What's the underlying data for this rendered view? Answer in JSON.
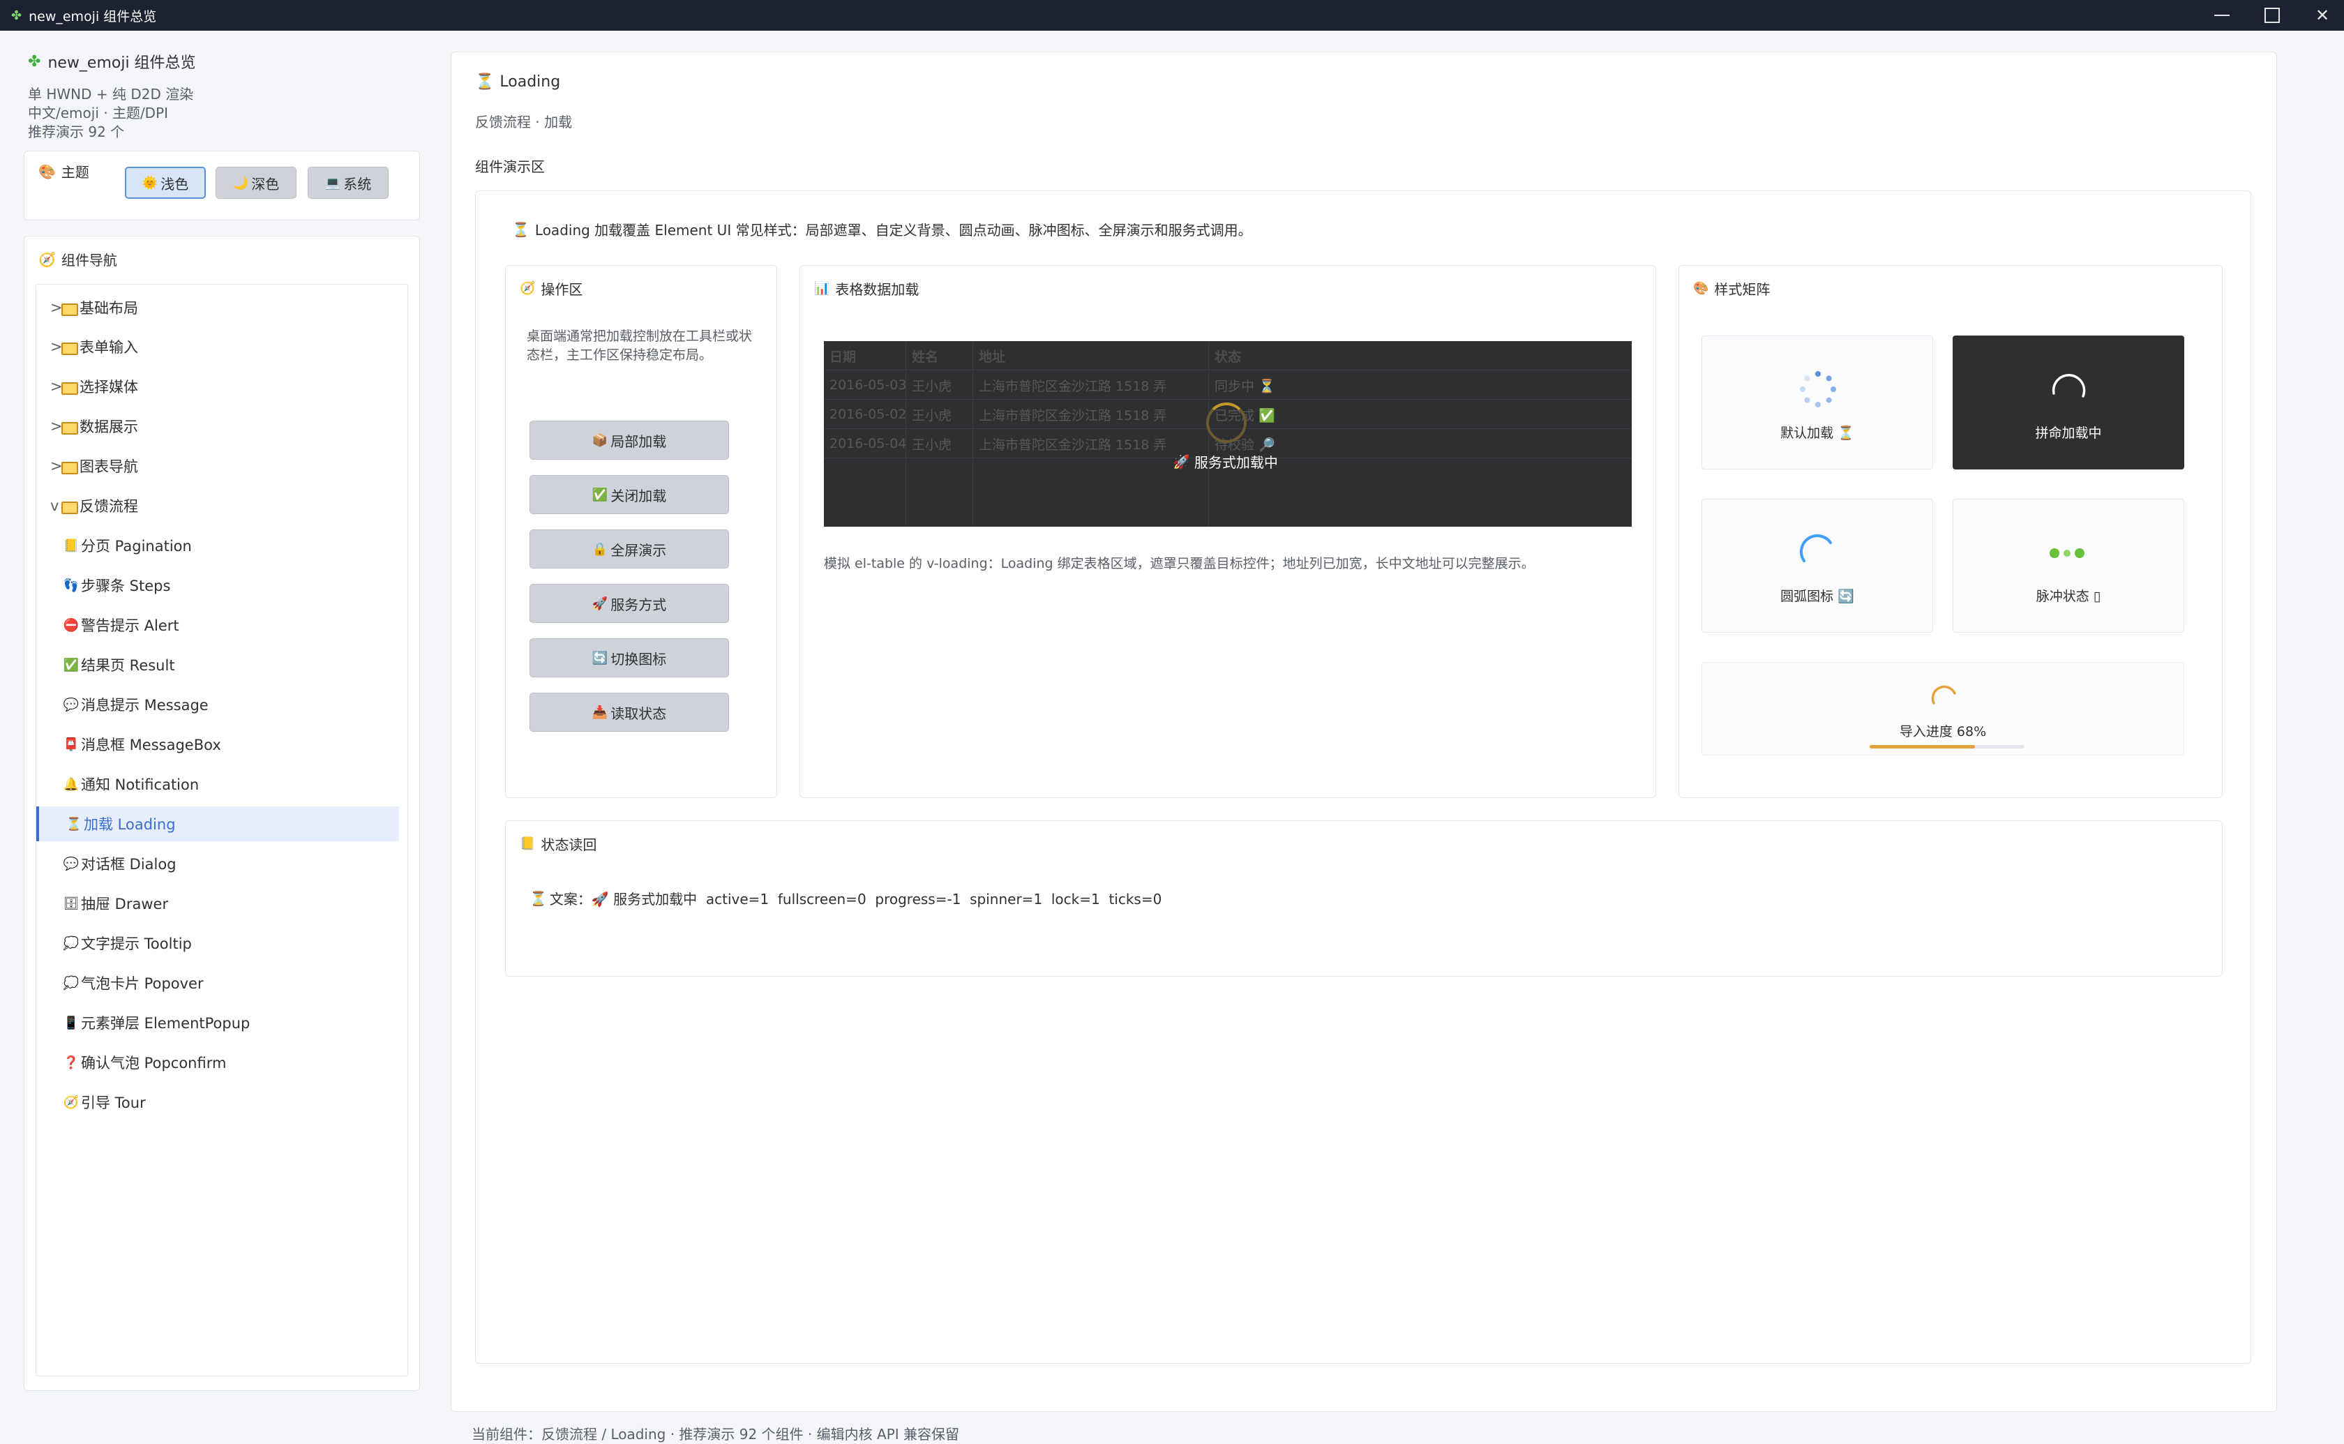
{
  "window": {
    "title": "new_emoji 组件总览",
    "icon": "clover-icon"
  },
  "sidebar": {
    "app_name": "new_emoji 组件总览",
    "meta_lines": [
      "单 HWND + 纯 D2D 渲染",
      "中文/emoji · 主题/DPI",
      "推荐演示 92 个"
    ],
    "theme": {
      "label": "主题",
      "buttons": [
        {
          "label": "浅色",
          "icon": "sun-icon",
          "selected": true
        },
        {
          "label": "深色",
          "icon": "moon-icon",
          "selected": false
        },
        {
          "label": "系统",
          "icon": "laptop-icon",
          "selected": false
        }
      ]
    },
    "nav": {
      "title": "组件导航",
      "groups": [
        {
          "prefix": ">",
          "label": "基础布局"
        },
        {
          "prefix": ">",
          "label": "表单输入"
        },
        {
          "prefix": ">",
          "label": "选择媒体"
        },
        {
          "prefix": ">",
          "label": "数据展示"
        },
        {
          "prefix": ">",
          "label": "图表导航"
        },
        {
          "prefix": "v",
          "label": "反馈流程"
        }
      ],
      "items": [
        {
          "label": "分页 Pagination",
          "icon": "📒"
        },
        {
          "label": "步骤条 Steps",
          "icon": "👣"
        },
        {
          "label": "警告提示 Alert",
          "icon": "⛔"
        },
        {
          "label": "结果页 Result",
          "icon": "✅"
        },
        {
          "label": "消息提示 Message",
          "icon": "💬"
        },
        {
          "label": "消息框 MessageBox",
          "icon": "📮"
        },
        {
          "label": "通知 Notification",
          "icon": "🔔"
        },
        {
          "label": "加载 Loading",
          "icon": "⏳",
          "active": true
        },
        {
          "label": "对话框 Dialog",
          "icon": "💬"
        },
        {
          "label": "抽屉 Drawer",
          "icon": "🗄"
        },
        {
          "label": "文字提示 Tooltip",
          "icon": "💭"
        },
        {
          "label": "气泡卡片 Popover",
          "icon": "💭"
        },
        {
          "label": "元素弹层 ElementPopup",
          "icon": "📱"
        },
        {
          "label": "确认气泡 Popconfirm",
          "icon": "❓"
        },
        {
          "label": "引导 Tour",
          "icon": "🧭"
        }
      ]
    }
  },
  "main": {
    "title": "Loading",
    "breadcrumb": "反馈流程 · 加载",
    "demo_label": "组件演示区",
    "intro": "Loading 加载覆盖 Element UI 常见样式：局部遮罩、自定义背景、圆点动画、脉冲图标、全屏演示和服务式调用。",
    "ops": {
      "title": "操作区",
      "description": "桌面端通常把加载控制放在工具栏或状态栏，主工作区保持稳定布局。",
      "buttons": [
        {
          "label": "局部加载",
          "icon": "📦"
        },
        {
          "label": "关闭加载",
          "icon": "✅"
        },
        {
          "label": "全屏演示",
          "icon": "🔒"
        },
        {
          "label": "服务方式",
          "icon": "🚀"
        },
        {
          "label": "切换图标",
          "icon": "🔄"
        },
        {
          "label": "读取状态",
          "icon": "📥"
        }
      ]
    },
    "table_panel": {
      "title": "表格数据加载",
      "columns": [
        "日期",
        "姓名",
        "地址",
        "状态"
      ],
      "rows": [
        [
          "2016-05-03",
          "王小虎",
          "上海市普陀区金沙江路 1518 弄",
          "同步中 ⏳"
        ],
        [
          "2016-05-02",
          "王小虎",
          "上海市普陀区金沙江路 1518 弄",
          "已完成 ✅"
        ],
        [
          "2016-05-04",
          "王小虎",
          "上海市普陀区金沙江路 1518 弄",
          "待校验 🔎"
        ]
      ],
      "overlay_text": "服务式加载中",
      "note": "模拟 el-table 的 v-loading：Loading 绑定表格区域，遮罩只覆盖目标控件；地址列已加宽，长中文地址可以完整展示。"
    },
    "style_panel": {
      "title": "样式矩阵",
      "cells": [
        {
          "label": "默认加载 ⏳"
        },
        {
          "label": "拼命加载中"
        },
        {
          "label": "圆弧图标 🔄"
        },
        {
          "label": "脉冲状态 ▯"
        }
      ],
      "progress": {
        "label": "导入进度 68%",
        "value": 0.68
      }
    },
    "status_panel": {
      "title": "状态读回",
      "line": "文案：🚀 服务式加载中  active=1  fullscreen=0  progress=-1  spinner=1  lock=1  ticks=0"
    }
  },
  "footer": "当前组件：反馈流程 / Loading · 推荐演示 92 个组件 · 编辑内核 API 兼容保留",
  "colors": {
    "accent": "#3a6fd1",
    "warning": "#e6a23c",
    "success": "#67c23a",
    "mask": "#2e2f31"
  }
}
